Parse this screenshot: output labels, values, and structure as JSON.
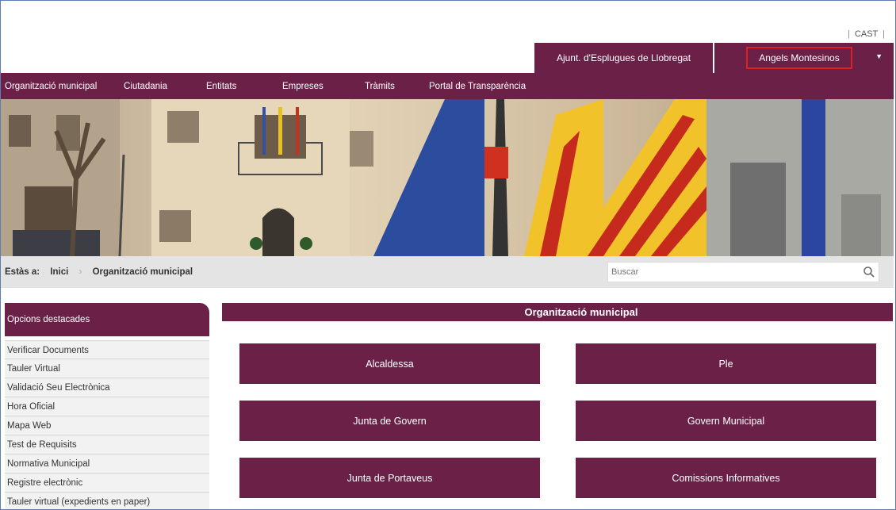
{
  "header": {
    "lang_prefix": "|",
    "lang_label": "CAST",
    "lang_suffix": "|",
    "ajuntament_label": "Ajunt. d'Esplugues de Llobregat",
    "user_label": "Angels Montesinos",
    "user_caret": "▼"
  },
  "nav": {
    "items": [
      "Organització municipal",
      "Ciutadania",
      "Entitats",
      "Empreses",
      "Tràmits",
      "Portal de Transparència"
    ]
  },
  "breadcrumb": {
    "label": "Estàs a:",
    "home": "Inici",
    "separator": "›",
    "current": "Organització municipal"
  },
  "search": {
    "placeholder": "Buscar"
  },
  "sidebar": {
    "title": "Opcions destacades",
    "items": [
      "Verificar Documents",
      "Tauler Virtual",
      "Validació Seu Electrònica",
      "Hora Oficial",
      "Mapa Web",
      "Test de Requisits",
      "Normativa Municipal",
      "Registre electrònic",
      "Tauler virtual (expedients en paper)"
    ]
  },
  "content": {
    "title": "Organització municipal",
    "tiles": [
      "Alcaldessa",
      "Ple",
      "Junta de Govern",
      "Govern Municipal",
      "Junta de Portaveus",
      "Comissions Informatives"
    ]
  },
  "colors": {
    "brand": "#6b2048",
    "highlight": "#e02020",
    "crumb_bar": "#e4e4e4"
  }
}
